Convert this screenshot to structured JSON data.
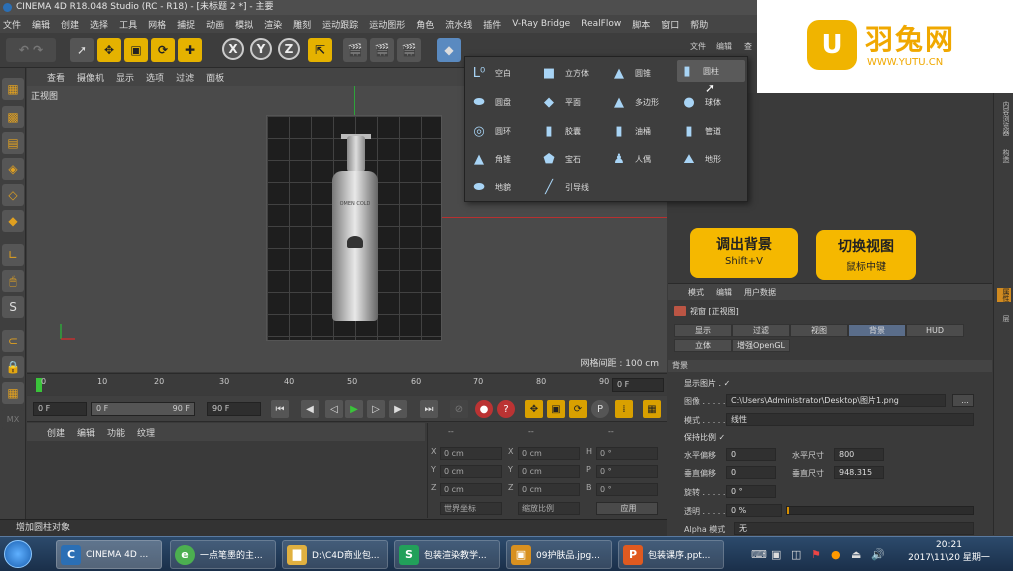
{
  "app": {
    "title": "CINEMA 4D R18.048 Studio (RC - R18) - [未标题 2 *] - 主要"
  },
  "menu": [
    "文件",
    "编辑",
    "创建",
    "选择",
    "工具",
    "网格",
    "捕捉",
    "动画",
    "模拟",
    "渲染",
    "雕刻",
    "运动跟踪",
    "运动图形",
    "角色",
    "流水线",
    "插件",
    "V-Ray Bridge",
    "RealFlow",
    "脚本",
    "窗口",
    "帮助"
  ],
  "toolbar": {
    "x": "X",
    "y": "Y",
    "z": "Z"
  },
  "viewport": {
    "menu": [
      "查看",
      "摄像机",
      "显示",
      "选项",
      "过滤",
      "面板"
    ],
    "label": "正视图",
    "grid_spacing": "网格间距 : 100 cm",
    "bottle_text": "OMEN COLD"
  },
  "timeline": {
    "ticks": [
      "0",
      "10",
      "20",
      "30",
      "40",
      "50",
      "60",
      "70",
      "80",
      "90"
    ],
    "end_frame": "0 F"
  },
  "playbar": {
    "start": "0 F",
    "range_start": "0 F",
    "range_end": "90 F",
    "end": "90 F"
  },
  "materials": {
    "menu": [
      "创建",
      "编辑",
      "功能",
      "纹理"
    ]
  },
  "coords": {
    "header": [
      "--",
      "--",
      "--"
    ],
    "rows": [
      {
        "a": "X",
        "av": "0 cm",
        "b": "X",
        "bv": "0 cm",
        "c": "H",
        "cv": "0 °"
      },
      {
        "a": "Y",
        "av": "0 cm",
        "b": "Y",
        "bv": "0 cm",
        "c": "P",
        "cv": "0 °"
      },
      {
        "a": "Z",
        "av": "0 cm",
        "b": "Z",
        "bv": "0 cm",
        "c": "B",
        "cv": "0 °"
      }
    ],
    "mode1": "世界坐标",
    "mode2": "缩放比例",
    "apply": "应用"
  },
  "status": "增加圆柱对象",
  "dropdown": [
    {
      "label": "空白",
      "icon": "L⁰"
    },
    {
      "label": "立方体",
      "icon": "■"
    },
    {
      "label": "圆锥",
      "icon": "▲"
    },
    {
      "label": "圆柱",
      "icon": "▮"
    },
    {
      "label": "圆盘",
      "icon": "⬬"
    },
    {
      "label": "平面",
      "icon": "◆"
    },
    {
      "label": "多边形",
      "icon": "▲"
    },
    {
      "label": "球体",
      "icon": "●"
    },
    {
      "label": "圆环",
      "icon": "◎"
    },
    {
      "label": "胶囊",
      "icon": "▮"
    },
    {
      "label": "油桶",
      "icon": "▮"
    },
    {
      "label": "管道",
      "icon": "▮"
    },
    {
      "label": "角锥",
      "icon": "▲"
    },
    {
      "label": "宝石",
      "icon": "⬟"
    },
    {
      "label": "人偶",
      "icon": "♟"
    },
    {
      "label": "地形",
      "icon": "⛰"
    },
    {
      "label": "地貌",
      "icon": "⬬"
    },
    {
      "label": "引导线",
      "icon": "╱"
    }
  ],
  "watermark": {
    "logo": "U",
    "title": "羽兔网",
    "url": "WWW.YUTU.CN"
  },
  "right_top": {
    "file": "文件",
    "edit": "编辑",
    "view": "查"
  },
  "tips": [
    {
      "title": "调出背景",
      "sub": "Shift+V"
    },
    {
      "title": "切换视图",
      "sub": "鼠标中键"
    }
  ],
  "rail": [
    "内容浏览器",
    "构造",
    "属性",
    "层"
  ],
  "attributes": {
    "menu": [
      "模式",
      "编辑",
      "用户数据"
    ],
    "title": "视窗 [正视图]",
    "tabs1": [
      "显示",
      "过滤",
      "视图",
      "背景",
      "HUD"
    ],
    "tabs2": [
      "立体",
      "增强OpenGL"
    ],
    "section": "背景",
    "show_image": "显示图片 . ✓",
    "image_label": "图像 . . . . . .",
    "image_path": "C:\\Users\\Administrator\\Desktop\\图片1.png",
    "browse": "...",
    "mode_label": "模式 . . . . . .",
    "mode_value": "线性",
    "keep_ratio": "保持比例 ✓",
    "h_offset_label": "水平偏移",
    "h_offset": "0",
    "h_size_label": "水平尺寸",
    "h_size": "800",
    "v_offset_label": "垂直偏移",
    "v_offset": "0",
    "v_size_label": "垂直尺寸",
    "v_size": "948.315",
    "rotate_label": "旋转 . . . . . .",
    "rotate": "0 °",
    "alpha_label": "透明 . . . . . .",
    "alpha": "0 %",
    "alpha_mode_label": "Alpha 模式",
    "alpha_mode": "无"
  },
  "taskbar": {
    "items": [
      {
        "label": "CINEMA 4D ...",
        "color": "#2b6fb5",
        "icon": "C"
      },
      {
        "label": "一点笔墨的主...",
        "color": "#4caf50",
        "icon": "e"
      },
      {
        "label": "D:\\C4D商业包...",
        "color": "#e0b040",
        "icon": "▇"
      },
      {
        "label": "包装渲染教学...",
        "color": "#22a05a",
        "icon": "S"
      },
      {
        "label": "09护肤品.jpg...",
        "color": "#d89020",
        "icon": "▣"
      },
      {
        "label": "包装课序.ppt...",
        "color": "#e05a20",
        "icon": "P"
      }
    ],
    "time": "20:21",
    "date": "2017\\11\\20 星期一"
  }
}
